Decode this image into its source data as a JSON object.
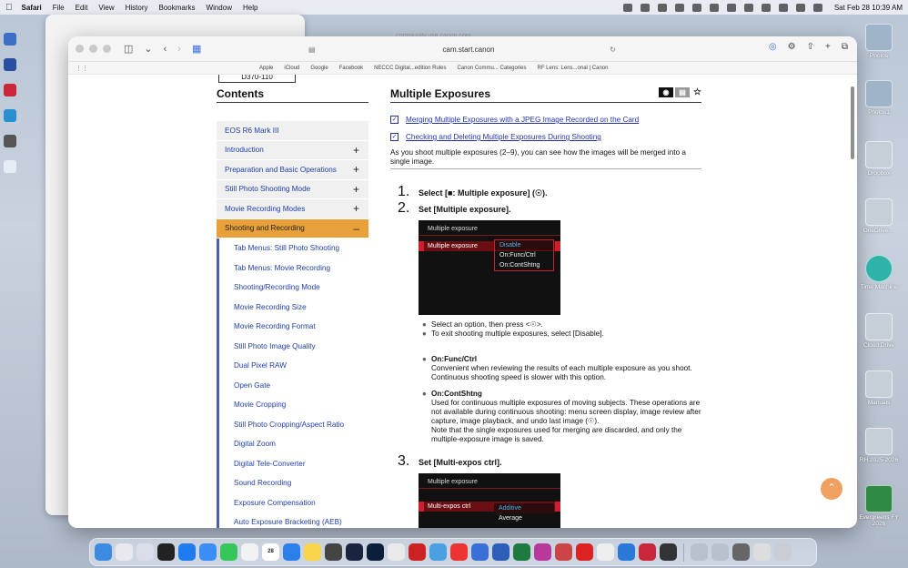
{
  "menubar": {
    "app": "Safari",
    "menus": [
      "File",
      "Edit",
      "View",
      "History",
      "Bookmarks",
      "Window",
      "Help"
    ],
    "clock": "Sat Feb 28  10:39 AM"
  },
  "bg_window": {
    "title": "community.usa.canon.com"
  },
  "toolbar": {
    "url": "cam.start.canon"
  },
  "favorites": [
    "Apple",
    "iCloud",
    "Google",
    "Facebook",
    "NECCC Digital...edition Rules",
    "Canon Commu... Categories",
    "RF Lens: Lens...onal | Canon"
  ],
  "model": "D370-110",
  "sidebar": {
    "title": "Contents",
    "items": [
      {
        "label": "EOS R6 Mark III",
        "plus": ""
      },
      {
        "label": "Introduction",
        "plus": "+"
      },
      {
        "label": "Preparation and Basic Operations",
        "plus": "+"
      },
      {
        "label": "Still Photo Shooting Mode",
        "plus": "+"
      },
      {
        "label": "Movie Recording Modes",
        "plus": "+"
      },
      {
        "label": "Shooting and Recording",
        "plus": "–"
      }
    ],
    "sub": [
      "Tab Menus: Still Photo Shooting",
      "Tab Menus: Movie Recording",
      "Shooting/Recording Mode",
      "Movie Recording Size",
      "Movie Recording Format",
      "Still Photo Image Quality",
      "Dual Pixel RAW",
      "Open Gate",
      "Movie Cropping",
      "Still Photo Cropping/Aspect Ratio",
      "Digital Zoom",
      "Digital Tele-Converter",
      "Sound Recording",
      "Exposure Compensation",
      "Auto Exposure Bracketing (AEB)"
    ]
  },
  "article": {
    "title": "Multiple Exposures",
    "links": [
      "Merging Multiple Exposures with a JPEG Image Recorded on the Card",
      "Checking and Deleting Multiple Exposures During Shooting"
    ],
    "intro": "As you shoot multiple exposures (2–9), you can see how the images will be merged into a single image.",
    "step1": {
      "num": "1.",
      "text": "Select [■: Multiple exposure] (☉)."
    },
    "step2": {
      "num": "2.",
      "text": "Set [Multiple exposure]."
    },
    "screen1": {
      "title": "Multiple exposure",
      "row": "Multiple exposure",
      "options": [
        "Disable",
        "On:Func/Ctrl",
        "On:ContShtng"
      ]
    },
    "bullets1": [
      "Select an option, then press <☉>.",
      "To exit shooting multiple exposures, select [Disable]."
    ],
    "func_ctrl": {
      "label": "On:Func/Ctrl",
      "desc": "Convenient when reviewing the results of each multiple exposure as you shoot. Continuous shooting speed is slower with this option."
    },
    "cont_shtng": {
      "label": "On:ContShtng",
      "desc": "Used for continuous multiple exposures of moving subjects. These operations are not available during continuous shooting: menu screen display, image review after capture, image playback, and undo last image (☉).",
      "note": "Note that the single exposures used for merging are discarded, and only the multiple-exposure image is saved."
    },
    "step3": {
      "num": "3.",
      "text": "Set [Multi-expos ctrl]."
    },
    "screen2": {
      "title": "Multiple exposure",
      "row": "Multi-expos ctrl",
      "options": [
        "Additive",
        "Average"
      ]
    }
  },
  "desktop": {
    "icons": [
      "Photos",
      "Photos1",
      "Dropbox",
      "OneDrive ...",
      "Time Machine",
      "Cloud Drive",
      "Manuals",
      "RH 2025-2026",
      "Evergreens FY 2026"
    ]
  },
  "dock": {
    "calendar_day": "28"
  }
}
